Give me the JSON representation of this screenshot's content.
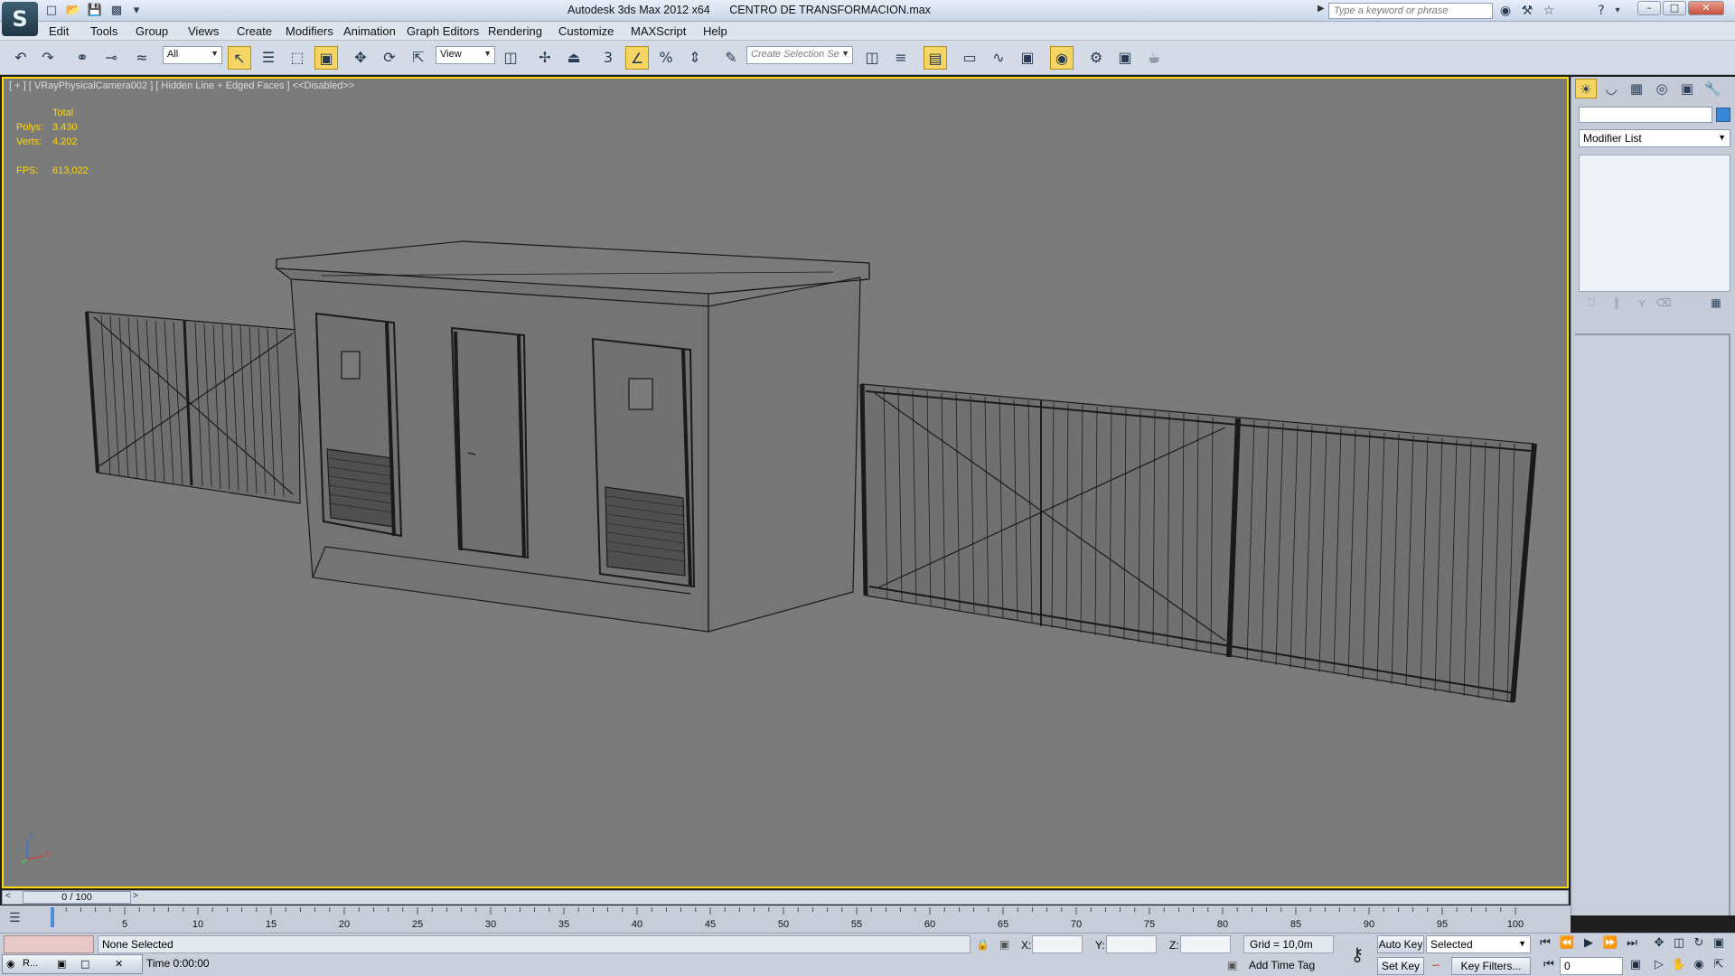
{
  "titlebar": {
    "app_title": "Autodesk 3ds Max  2012 x64",
    "file_name": "CENTRO DE TRANSFORMACION.max",
    "search_placeholder": "Type a keyword or phrase",
    "app_icon_glyph": "S"
  },
  "menu": [
    {
      "id": "edit",
      "label": "Edit"
    },
    {
      "id": "tools",
      "label": "Tools"
    },
    {
      "id": "group",
      "label": "Group"
    },
    {
      "id": "views",
      "label": "Views"
    },
    {
      "id": "create",
      "label": "Create"
    },
    {
      "id": "modifiers",
      "label": "Modifiers"
    },
    {
      "id": "animation",
      "label": "Animation"
    },
    {
      "id": "graph-editors",
      "label": "Graph Editors"
    },
    {
      "id": "rendering",
      "label": "Rendering"
    },
    {
      "id": "customize",
      "label": "Customize"
    },
    {
      "id": "maxscript",
      "label": "MAXScript"
    },
    {
      "id": "help",
      "label": "Help"
    }
  ],
  "toolbar": {
    "selection_filter": "All",
    "reference_coord": "View",
    "selection_set_placeholder": "Create Selection Se",
    "snap_label": "3",
    "angle_snap_label": "%"
  },
  "viewport": {
    "label": "[ + ] [ VRayPhysicalCamera002 ] [ Hidden Line + Edged Faces ] <<Disabled>>",
    "stats_total": "Total",
    "polys_label": "Polys:",
    "polys_value": "3.430",
    "verts_label": "Verts:",
    "verts_value": "4.202",
    "fps_label": "FPS:",
    "fps_value": "613,022",
    "axis_x": "x",
    "axis_z": "z",
    "background_color": "#7b7b7b",
    "active_border_color": "#ffd800"
  },
  "command_panel": {
    "modifier_list": "Modifier List",
    "object_color": "#3a86d8",
    "tabs": [
      "create-tab",
      "modify-tab",
      "hierarchy-tab",
      "motion-tab",
      "display-tab",
      "utilities-tab"
    ]
  },
  "timeline": {
    "slider_label": "0 / 100",
    "ticks": [
      "5",
      "10",
      "15",
      "20",
      "25",
      "30",
      "35",
      "40",
      "45",
      "50",
      "55",
      "60",
      "65",
      "70",
      "75",
      "80",
      "85",
      "90",
      "95",
      "100"
    ]
  },
  "status": {
    "selection_msg": "None Selected",
    "time_label": "Time  0:00:00",
    "taskbar_label": "R...",
    "x_label": "X:",
    "y_label": "Y:",
    "z_label": "Z:",
    "grid": "Grid = 10,0m",
    "add_time_tag": "Add Time Tag",
    "auto_key": "Auto Key",
    "set_key": "Set Key",
    "selected_combo": "Selected",
    "key_filters": "Key Filters...",
    "frame_value": "0"
  }
}
